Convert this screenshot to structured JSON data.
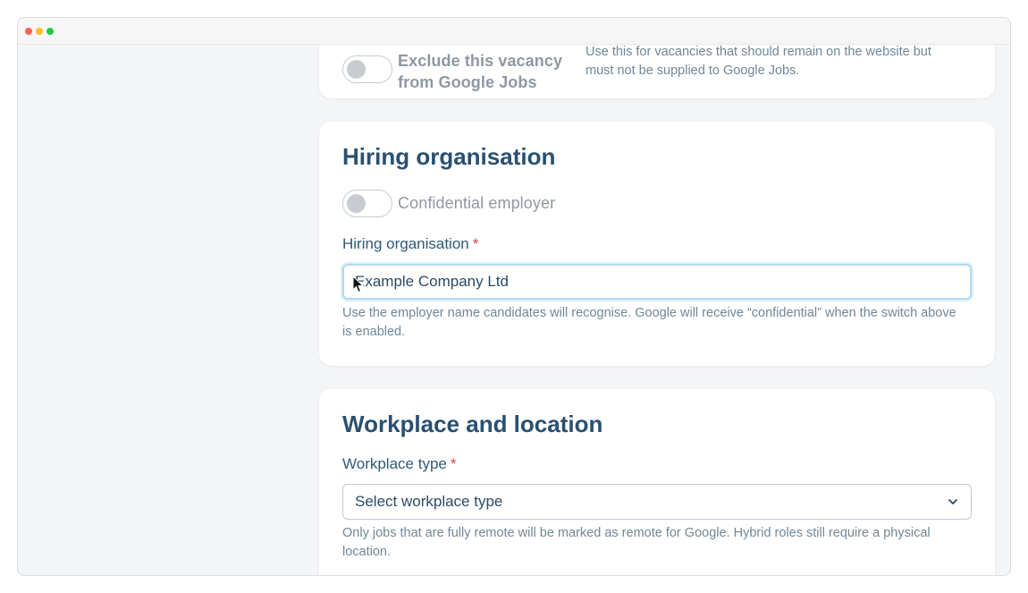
{
  "window": {
    "controls": [
      "close",
      "minimize",
      "maximize"
    ]
  },
  "google_jobs_card": {
    "toggle_label": "Exclude this vacancy from Google Jobs",
    "toggle_on": false,
    "help": "Use this for vacancies that should remain on the website but must not be supplied to Google Jobs."
  },
  "hiring_card": {
    "title": "Hiring organisation",
    "confidential_toggle_label": "Confidential employer",
    "confidential_toggle_on": false,
    "field_label": "Hiring organisation",
    "required_marker": "*",
    "input_value": "Example Company Ltd",
    "help": "Use the employer name candidates will recognise. Google will receive “confidential” when the switch above is enabled."
  },
  "workplace_card": {
    "title": "Workplace and location",
    "field_label": "Workplace type",
    "required_marker": "*",
    "select_value": "Select workplace type",
    "help": "Only jobs that are fully remote will be marked as remote for Google. Hybrid roles still require a physical location."
  },
  "colors": {
    "title": "#2a5070",
    "label": "#2f5a77",
    "help": "#6f8799",
    "required": "#d9463a",
    "focus_ring": "#b4d9f2"
  },
  "icons": {
    "select_caret": "chevron-down-icon",
    "pointer": "mouse-pointer-icon"
  }
}
